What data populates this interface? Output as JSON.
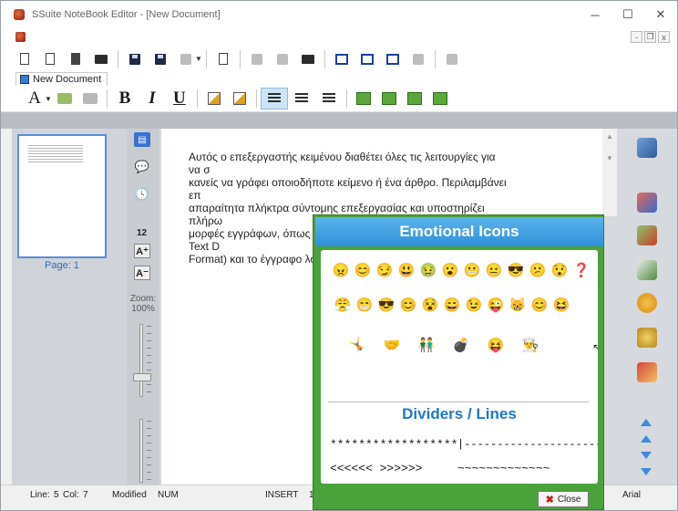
{
  "window": {
    "title": "SSuite NoteBook Editor - [New Document]",
    "minimize": "─",
    "maximize": "☐",
    "close": "✕"
  },
  "mdi": {
    "minimize": "-",
    "restore": "❐",
    "close": "x"
  },
  "tab": {
    "label": "New Document"
  },
  "toolbar2": {
    "font_glyph": "A",
    "bold": "B",
    "italic": "I",
    "underline": "U"
  },
  "sidebar": {
    "page_label": "Page: 1",
    "font_size": "12",
    "zoom_label": "Zoom: 100%"
  },
  "document": {
    "text": "Αυτός ο επεξεργαστής κειμένου διαθέτει όλες τις λειτουργίες για να σ\nκανείς να γράφει οποιοδήποτε κείμενο ή ένα άρθρο. Περιλαμβάνει επ\nαπαραίτητα πλήκτρα σύντομης επεξεργασίας και υποστηρίζει πλήρω\nμορφές εγγράφων, όπως το μορφότυπο εγγράφου RTF (Rich Text D\nFormat) και το έγγραφο λογιστικού φύλλου Excel."
  },
  "popup": {
    "title": "Emotional Icons",
    "emoji_row1": [
      "😠",
      "😊",
      "😏",
      "😃",
      "🤢",
      "😮",
      "😬",
      "😐",
      "😎",
      "😕",
      "😯",
      "❓"
    ],
    "emoji_row2": [
      "😤",
      "😁",
      "😎",
      "😊",
      "😵",
      "😄",
      "😉",
      "😜",
      "😸",
      "😊",
      "😆"
    ],
    "emoji_row3": [
      "🤸",
      "🤝",
      "👬",
      "💣",
      "😝",
      "👨‍🍳"
    ],
    "dividers_title": "Dividers / Lines",
    "lines": [
      "******************",
      "|-----------------------|",
      "<<<<<< >>>>>>",
      "~~~~~~~~~~~~~",
      "••••••••••••••••••••••",
      "============"
    ],
    "close_label": "Close"
  },
  "status": {
    "line": "Line:",
    "line_val": "5",
    "col": "Col:",
    "col_val": "7",
    "modified": "Modified",
    "num": "NUM",
    "insert": "INSERT",
    "one": "1",
    "font": "Arial"
  }
}
